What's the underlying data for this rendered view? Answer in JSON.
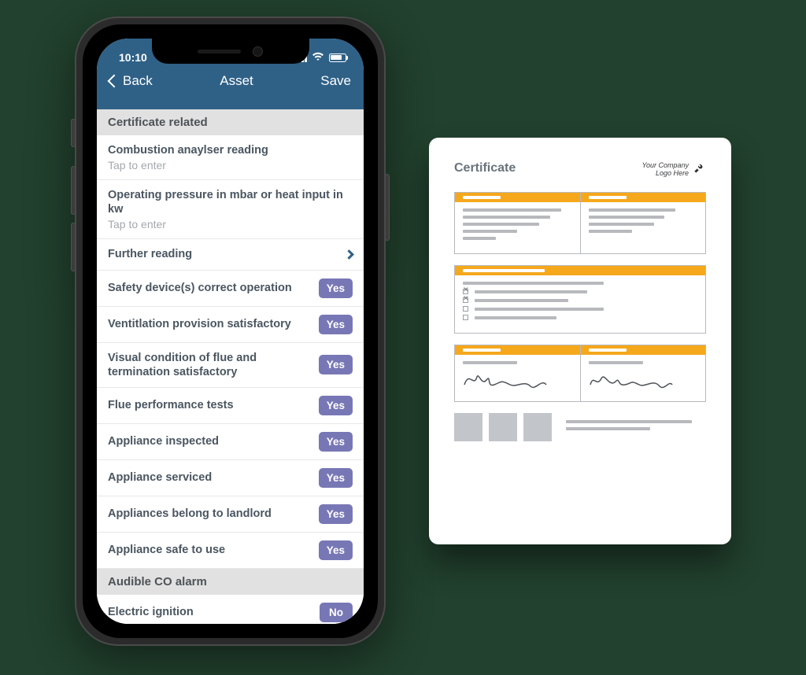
{
  "phone": {
    "status": {
      "time": "10:10"
    },
    "nav": {
      "back": "Back",
      "title": "Asset",
      "save": "Save"
    },
    "sections": {
      "cert_related": {
        "header": "Certificate related",
        "combustion_label": "Combustion anaylser reading",
        "combustion_sub": "Tap to enter",
        "operating_label": "Operating pressure in mbar or heat input in kw",
        "operating_sub": "Tap to enter",
        "further_label": "Further reading",
        "safety_label": "Safety device(s) correct operation",
        "safety_val": "Yes",
        "vent_label": "Ventitlation provision satisfactory",
        "vent_val": "Yes",
        "flue_visual_label": "Visual condition of flue and termination satisfactory",
        "flue_visual_val": "Yes",
        "flue_perf_label": "Flue performance tests",
        "flue_perf_val": "Yes",
        "inspected_label": "Appliance inspected",
        "inspected_val": "Yes",
        "serviced_label": "Appliance serviced",
        "serviced_val": "Yes",
        "landlord_label": "Appliances belong to landlord",
        "landlord_val": "Yes",
        "safe_label": "Appliance safe to use",
        "safe_val": "Yes"
      },
      "co_alarm": {
        "header": "Audible CO alarm",
        "electric_label": "Electric ignition",
        "electric_val": "No"
      }
    }
  },
  "certificate": {
    "title": "Certificate",
    "logo_text": "Your Company\nLogo Here"
  },
  "colors": {
    "navbar": "#2f6187",
    "toggle": "#7877b6",
    "accent": "#f5a81c"
  }
}
